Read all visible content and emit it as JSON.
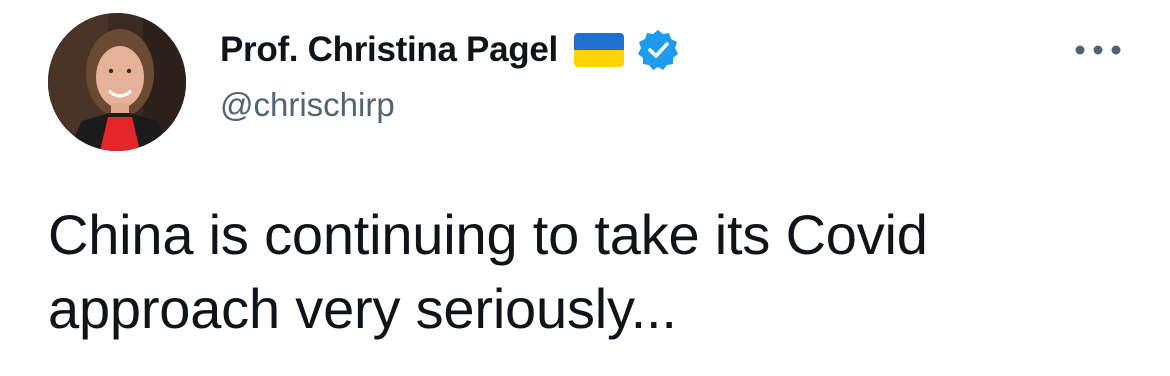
{
  "author": {
    "display_name": "Prof. Christina Pagel",
    "handle": "@chrischirp",
    "flag_icon": "ukraine-flag-icon",
    "verified_icon": "verified-badge-icon",
    "verified_color": "#1d9bf0"
  },
  "tweet": {
    "text": "China is continuing to take its Covid approach very seriously..."
  },
  "more_icon": "more-options-icon",
  "colors": {
    "text": "#0f1419",
    "secondary": "#536471",
    "flag_blue": "#1f6fd1",
    "flag_yellow": "#ffd400"
  }
}
